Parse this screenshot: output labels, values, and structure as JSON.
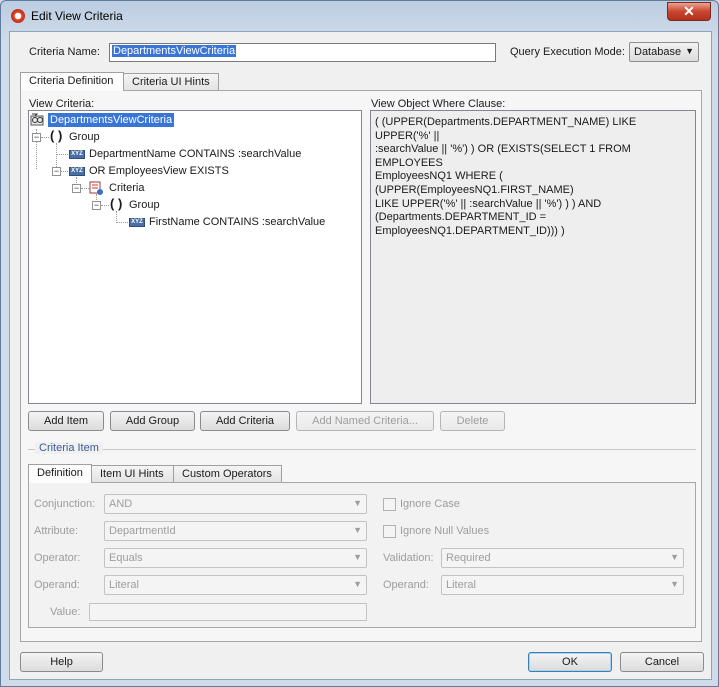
{
  "window": {
    "title": "Edit View Criteria",
    "close_glyph": "✕"
  },
  "header": {
    "criteria_name_label": "Criteria Name:",
    "criteria_name_value": "DepartmentsViewCriteria",
    "query_mode_label": "Query Execution Mode:",
    "query_mode_value": "Database"
  },
  "tabs": [
    "Criteria Definition",
    "Criteria UI Hints"
  ],
  "view_criteria": {
    "label": "View Criteria:",
    "tree": [
      {
        "text": "DepartmentsViewCriteria",
        "icon": "view-criteria-icon",
        "selected": true
      },
      {
        "text": "Group",
        "icon": "group-parens-icon"
      },
      {
        "text": "DepartmentName CONTAINS :searchValue",
        "icon": "xyz-attribute-icon"
      },
      {
        "text": "OR EmployeesView EXISTS",
        "icon": "xyz-attribute-icon"
      },
      {
        "text": "Criteria",
        "icon": "criteria-icon"
      },
      {
        "text": "Group",
        "icon": "group-parens-icon"
      },
      {
        "text": "FirstName CONTAINS :searchValue",
        "icon": "xyz-attribute-icon"
      }
    ]
  },
  "where_clause": {
    "label": "View Object Where Clause:",
    "lines": [
      "( (UPPER(Departments.DEPARTMENT_NAME) LIKE UPPER('%' ||",
      ":searchValue || '%') ) OR (EXISTS(SELECT 1 FROM EMPLOYEES",
      "EmployeesNQ1 WHERE  ( (UPPER(EmployeesNQ1.FIRST_NAME)",
      "LIKE UPPER('%' || :searchValue || '%') ) )  AND",
      "(Departments.DEPARTMENT_ID =",
      "EmployeesNQ1.DEPARTMENT_ID))) )"
    ]
  },
  "action_buttons": {
    "add_item": "Add Item",
    "add_group": "Add Group",
    "add_criteria": "Add Criteria",
    "add_named_criteria": "Add Named Criteria...",
    "delete": "Delete"
  },
  "criteria_item": {
    "title": "Criteria Item",
    "tabs": [
      "Definition",
      "Item UI Hints",
      "Custom Operators"
    ],
    "fields": {
      "conjunction_label": "Conjunction:",
      "conjunction_value": "AND",
      "attribute_label": "Attribute:",
      "attribute_value": "DepartmentId",
      "operator_label": "Operator:",
      "operator_value": "Equals",
      "operand_label": "Operand:",
      "operand_value": "Literal",
      "value_label": "Value:",
      "ignore_case_label": "Ignore Case",
      "ignore_null_label": "Ignore Null Values",
      "validation_label": "Validation:",
      "validation_value": "Required",
      "operand2_label": "Operand:",
      "operand2_value": "Literal"
    }
  },
  "footer": {
    "help": "Help",
    "ok": "OK",
    "cancel": "Cancel"
  }
}
